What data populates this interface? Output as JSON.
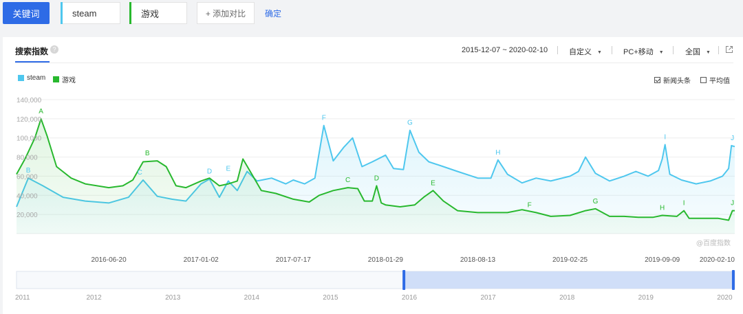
{
  "topbar": {
    "keyword_button": "关键词",
    "terms": [
      {
        "label": "steam",
        "color": "#4ec7ee"
      },
      {
        "label": "游戏",
        "color": "#28b82e"
      }
    ],
    "add_compare": "+ 添加对比",
    "confirm": "确定"
  },
  "panel": {
    "tab": "搜索指数",
    "date_range": "2015-12-07 ~ 2020-02-10",
    "custom": "自定义",
    "device": "PC+移动",
    "region": "全国",
    "help_icon": "question-icon",
    "export_icon": "external-link-icon"
  },
  "options": {
    "news_headlines": {
      "label": "新闻头条",
      "checked": true
    },
    "average": {
      "label": "平均值",
      "checked": false
    }
  },
  "chart_data": {
    "type": "area",
    "y_ticks": [
      "140,000",
      "120,000",
      "100,000",
      "80,000",
      "60,000",
      "40,000",
      "20,000"
    ],
    "ylim": [
      0,
      140000
    ],
    "x_ticks": [
      "2016-06-20",
      "2017-01-02",
      "2017-07-17",
      "2018-01-29",
      "2018-08-13",
      "2019-02-25",
      "2019-09-09",
      "2020-02-10"
    ],
    "x_range": [
      "2015-12-07",
      "2020-02-10"
    ],
    "watermark": "@百度指数",
    "grid": true,
    "series": [
      {
        "name": "steam",
        "color": "#4ec7ee",
        "points": [
          [
            "2015-12-07",
            28000
          ],
          [
            "2016-01-01",
            58000
          ],
          [
            "2016-02-01",
            50000
          ],
          [
            "2016-03-15",
            38000
          ],
          [
            "2016-05-01",
            34000
          ],
          [
            "2016-06-20",
            32000
          ],
          [
            "2016-08-01",
            38000
          ],
          [
            "2016-09-01",
            56000
          ],
          [
            "2016-10-01",
            39000
          ],
          [
            "2016-11-01",
            36000
          ],
          [
            "2016-12-01",
            34000
          ],
          [
            "2017-01-02",
            52000
          ],
          [
            "2017-01-20",
            57000
          ],
          [
            "2017-02-10",
            38000
          ],
          [
            "2017-03-01",
            55000
          ],
          [
            "2017-03-20",
            45000
          ],
          [
            "2017-04-10",
            65000
          ],
          [
            "2017-05-01",
            55000
          ],
          [
            "2017-06-01",
            58000
          ],
          [
            "2017-07-01",
            52000
          ],
          [
            "2017-07-17",
            56000
          ],
          [
            "2017-08-10",
            52000
          ],
          [
            "2017-09-01",
            58000
          ],
          [
            "2017-09-20",
            113000
          ],
          [
            "2017-10-10",
            76000
          ],
          [
            "2017-11-01",
            90000
          ],
          [
            "2017-11-20",
            100000
          ],
          [
            "2017-12-10",
            70000
          ],
          [
            "2018-01-01",
            75000
          ],
          [
            "2018-01-29",
            82000
          ],
          [
            "2018-02-15",
            68000
          ],
          [
            "2018-03-08",
            67000
          ],
          [
            "2018-03-22",
            108000
          ],
          [
            "2018-04-10",
            85000
          ],
          [
            "2018-05-01",
            75000
          ],
          [
            "2018-06-01",
            70000
          ],
          [
            "2018-07-01",
            65000
          ],
          [
            "2018-08-13",
            58000
          ],
          [
            "2018-09-10",
            58000
          ],
          [
            "2018-09-25",
            77000
          ],
          [
            "2018-10-15",
            62000
          ],
          [
            "2018-11-15",
            53000
          ],
          [
            "2018-12-15",
            58000
          ],
          [
            "2019-01-15",
            55000
          ],
          [
            "2019-02-25",
            60000
          ],
          [
            "2019-03-15",
            65000
          ],
          [
            "2019-03-30",
            80000
          ],
          [
            "2019-04-20",
            63000
          ],
          [
            "2019-05-20",
            55000
          ],
          [
            "2019-06-20",
            60000
          ],
          [
            "2019-07-15",
            65000
          ],
          [
            "2019-08-10",
            60000
          ],
          [
            "2019-09-01",
            66000
          ],
          [
            "2019-09-09",
            78000
          ],
          [
            "2019-09-15",
            93000
          ],
          [
            "2019-09-25",
            62000
          ],
          [
            "2019-10-20",
            56000
          ],
          [
            "2019-11-20",
            52000
          ],
          [
            "2019-12-20",
            55000
          ],
          [
            "2020-01-15",
            60000
          ],
          [
            "2020-01-28",
            68000
          ],
          [
            "2020-02-03",
            92000
          ],
          [
            "2020-02-10",
            91000
          ]
        ]
      },
      {
        "name": "游戏",
        "color": "#28b82e",
        "points": [
          [
            "2015-12-07",
            62000
          ],
          [
            "2015-12-25",
            78000
          ],
          [
            "2016-01-15",
            100000
          ],
          [
            "2016-01-28",
            120000
          ],
          [
            "2016-02-10",
            102000
          ],
          [
            "2016-03-01",
            70000
          ],
          [
            "2016-04-01",
            58000
          ],
          [
            "2016-05-01",
            52000
          ],
          [
            "2016-06-20",
            48000
          ],
          [
            "2016-07-20",
            50000
          ],
          [
            "2016-08-10",
            56000
          ],
          [
            "2016-09-01",
            75000
          ],
          [
            "2016-10-01",
            76000
          ],
          [
            "2016-10-20",
            70000
          ],
          [
            "2016-11-10",
            50000
          ],
          [
            "2016-12-01",
            48000
          ],
          [
            "2017-01-02",
            55000
          ],
          [
            "2017-01-20",
            58000
          ],
          [
            "2017-02-10",
            50000
          ],
          [
            "2017-03-01",
            52000
          ],
          [
            "2017-03-20",
            55000
          ],
          [
            "2017-04-01",
            78000
          ],
          [
            "2017-04-20",
            62000
          ],
          [
            "2017-05-10",
            45000
          ],
          [
            "2017-06-10",
            42000
          ],
          [
            "2017-07-17",
            36000
          ],
          [
            "2017-08-20",
            33000
          ],
          [
            "2017-09-10",
            40000
          ],
          [
            "2017-10-10",
            45000
          ],
          [
            "2017-11-10",
            48000
          ],
          [
            "2017-12-01",
            47000
          ],
          [
            "2017-12-15",
            34000
          ],
          [
            "2018-01-01",
            34000
          ],
          [
            "2018-01-10",
            50000
          ],
          [
            "2018-01-20",
            32000
          ],
          [
            "2018-01-29",
            30000
          ],
          [
            "2018-03-01",
            28000
          ],
          [
            "2018-04-01",
            30000
          ],
          [
            "2018-04-20",
            38000
          ],
          [
            "2018-05-10",
            45000
          ],
          [
            "2018-06-01",
            34000
          ],
          [
            "2018-07-01",
            24000
          ],
          [
            "2018-08-13",
            22000
          ],
          [
            "2018-09-15",
            22000
          ],
          [
            "2018-10-15",
            22000
          ],
          [
            "2018-11-15",
            25000
          ],
          [
            "2018-12-15",
            22000
          ],
          [
            "2019-01-15",
            18000
          ],
          [
            "2019-02-25",
            19000
          ],
          [
            "2019-03-30",
            24000
          ],
          [
            "2019-04-20",
            26000
          ],
          [
            "2019-05-20",
            18000
          ],
          [
            "2019-06-20",
            18000
          ],
          [
            "2019-07-20",
            17000
          ],
          [
            "2019-08-20",
            17000
          ],
          [
            "2019-09-09",
            19000
          ],
          [
            "2019-10-10",
            18000
          ],
          [
            "2019-10-25",
            24000
          ],
          [
            "2019-11-05",
            16000
          ],
          [
            "2019-12-05",
            16000
          ],
          [
            "2020-01-05",
            16000
          ],
          [
            "2020-01-28",
            14000
          ],
          [
            "2020-02-05",
            24000
          ],
          [
            "2020-02-10",
            24000
          ]
        ]
      }
    ],
    "annotations": [
      {
        "series": "游戏",
        "label": "A",
        "date": "2016-01-28",
        "value": 120000
      },
      {
        "series": "steam",
        "label": "B",
        "date": "2016-01-01",
        "value": 58000
      },
      {
        "series": "游戏",
        "label": "B",
        "date": "2016-09-10",
        "value": 76000
      },
      {
        "series": "steam",
        "label": "C",
        "date": "2016-08-25",
        "value": 56000
      },
      {
        "series": "steam",
        "label": "D",
        "date": "2017-01-20",
        "value": 57000
      },
      {
        "series": "steam",
        "label": "E",
        "date": "2017-03-01",
        "value": 60000
      },
      {
        "series": "steam",
        "label": "F",
        "date": "2017-09-20",
        "value": 113000
      },
      {
        "series": "游戏",
        "label": "C",
        "date": "2017-11-10",
        "value": 48000
      },
      {
        "series": "游戏",
        "label": "D",
        "date": "2018-01-10",
        "value": 50000
      },
      {
        "series": "steam",
        "label": "G",
        "date": "2018-03-22",
        "value": 108000
      },
      {
        "series": "游戏",
        "label": "E",
        "date": "2018-05-10",
        "value": 45000
      },
      {
        "series": "steam",
        "label": "H",
        "date": "2018-09-25",
        "value": 77000
      },
      {
        "series": "游戏",
        "label": "F",
        "date": "2018-12-01",
        "value": 22000
      },
      {
        "series": "游戏",
        "label": "G",
        "date": "2019-04-20",
        "value": 26000
      },
      {
        "series": "steam",
        "label": "I",
        "date": "2019-09-15",
        "value": 93000
      },
      {
        "series": "游戏",
        "label": "H",
        "date": "2019-09-09",
        "value": 19000
      },
      {
        "series": "游戏",
        "label": "I",
        "date": "2019-10-25",
        "value": 24000
      },
      {
        "series": "steam",
        "label": "J",
        "date": "2020-02-05",
        "value": 92000
      },
      {
        "series": "游戏",
        "label": "J",
        "date": "2020-02-05",
        "value": 24000
      }
    ],
    "overview": {
      "years": [
        "2011",
        "2012",
        "2013",
        "2014",
        "2015",
        "2016",
        "2017",
        "2018",
        "2019",
        "2020"
      ],
      "selection": [
        "2015-12-07",
        "2020-02-10"
      ]
    }
  }
}
